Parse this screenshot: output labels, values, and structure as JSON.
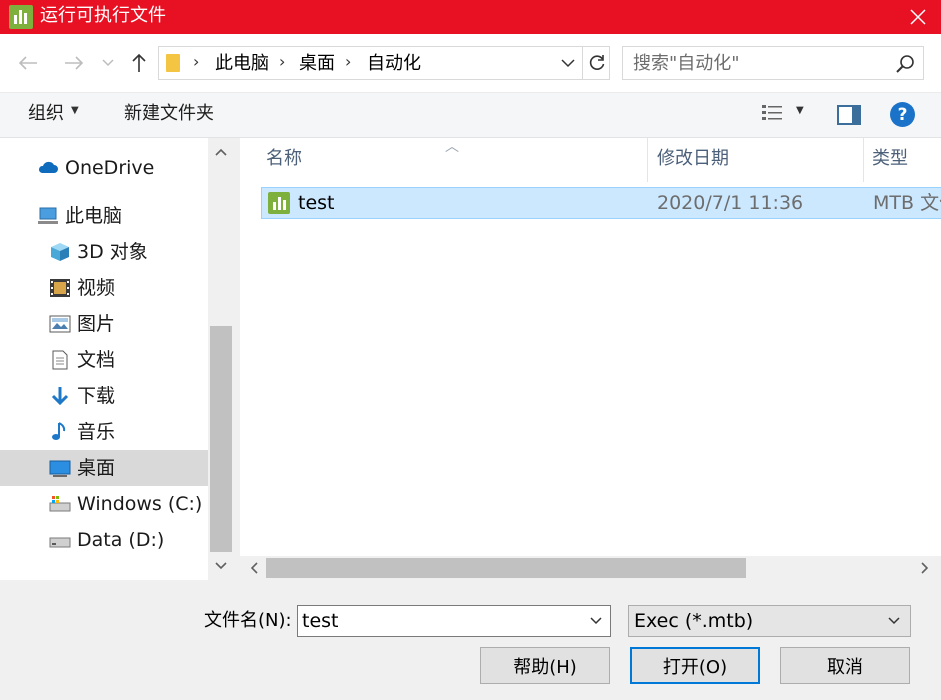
{
  "window": {
    "title": "运行可执行文件",
    "close_glyph": "✕"
  },
  "address": {
    "breadcrumbs": [
      "此电脑",
      "桌面",
      "自动化"
    ],
    "search_placeholder": "搜索\"自动化\""
  },
  "toolbar": {
    "organize": "组织",
    "new_folder": "新建文件夹",
    "help_glyph": "?"
  },
  "nav": {
    "items": [
      {
        "label": "OneDrive",
        "icon": "cloud-icon",
        "selected": false
      },
      {
        "label": "此电脑",
        "icon": "computer-icon",
        "selected": false
      },
      {
        "label": "3D 对象",
        "icon": "cube-icon",
        "selected": false
      },
      {
        "label": "视频",
        "icon": "video-icon",
        "selected": false
      },
      {
        "label": "图片",
        "icon": "picture-icon",
        "selected": false
      },
      {
        "label": "文档",
        "icon": "document-icon",
        "selected": false
      },
      {
        "label": "下载",
        "icon": "download-icon",
        "selected": false
      },
      {
        "label": "音乐",
        "icon": "music-icon",
        "selected": false
      },
      {
        "label": "桌面",
        "icon": "desktop-icon",
        "selected": true
      },
      {
        "label": "Windows (C:)",
        "icon": "drive-icon",
        "selected": false
      },
      {
        "label": "Data (D:)",
        "icon": "drive-icon",
        "selected": false
      }
    ]
  },
  "files": {
    "columns": {
      "name": "名称",
      "modified": "修改日期",
      "type": "类型"
    },
    "rows": [
      {
        "name": "test",
        "modified": "2020/7/1 11:36",
        "type": "MTB 文件",
        "selected": true
      }
    ]
  },
  "bottom": {
    "filename_label": "文件名(N):",
    "filename_value": "test",
    "filetype_value": "Exec (*.mtb)",
    "help_button": "帮助(H)",
    "open_button": "打开(O)",
    "cancel_button": "取消"
  },
  "colors": {
    "titlebar": "#e81123",
    "selection": "#cce8ff",
    "accent": "#0078d7",
    "app_icon": "#7db03c"
  }
}
